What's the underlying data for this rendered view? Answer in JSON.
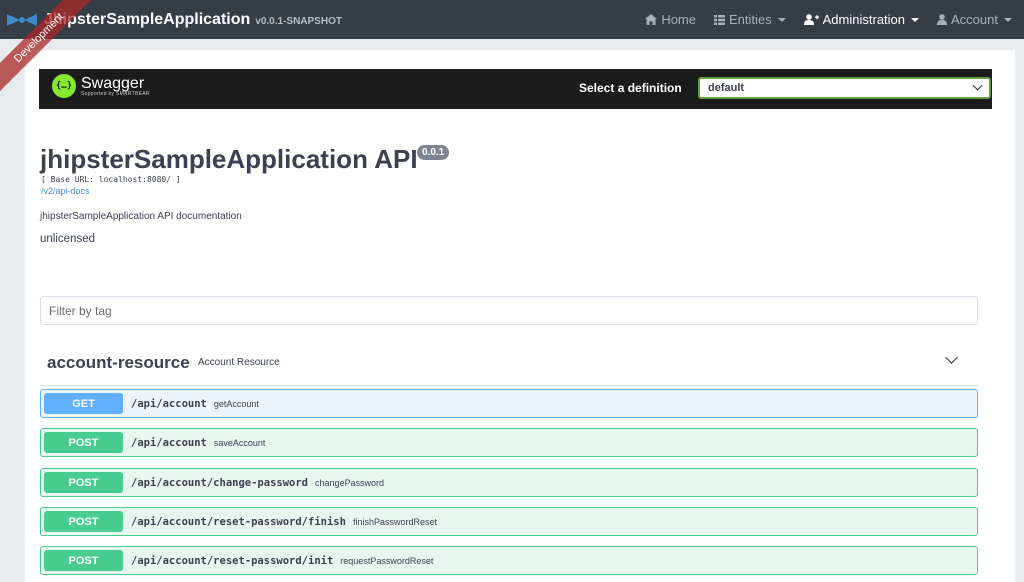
{
  "navbar": {
    "app_name": "JhipsterSampleApplication",
    "version": "v0.0.1-SNAPSHOT",
    "ribbon": "Development",
    "items": [
      {
        "label": "Home",
        "icon": "home-icon"
      },
      {
        "label": "Entities",
        "icon": "list-icon"
      },
      {
        "label": "Administration",
        "icon": "user-plus-icon"
      },
      {
        "label": "Account",
        "icon": "user-icon"
      }
    ]
  },
  "swagger": {
    "logo_text": "Swagger",
    "logo_subtext": "Supported by SMARTBEAR",
    "select_label": "Select a definition",
    "selected_definition": "default"
  },
  "info": {
    "title": "jhipsterSampleApplication API",
    "version": "0.0.1",
    "base_url": "[ Base URL: localhost:8080/ ]",
    "docs_link": "/v2/api-docs",
    "description": "jhipsterSampleApplication API documentation",
    "license": "unlicensed"
  },
  "filter": {
    "placeholder": "Filter by tag"
  },
  "tag": {
    "name": "account-resource",
    "description": "Account Resource"
  },
  "operations": [
    {
      "method": "GET",
      "path": "/api/account",
      "summary": "getAccount"
    },
    {
      "method": "POST",
      "path": "/api/account",
      "summary": "saveAccount"
    },
    {
      "method": "POST",
      "path": "/api/account/change-password",
      "summary": "changePassword"
    },
    {
      "method": "POST",
      "path": "/api/account/reset-password/finish",
      "summary": "finishPasswordReset"
    },
    {
      "method": "POST",
      "path": "/api/account/reset-password/init",
      "summary": "requestPasswordReset"
    }
  ],
  "colors": {
    "navbar": "#353d47",
    "get": "#61affe",
    "post": "#49cc90",
    "swagger_green": "#85ea2d"
  }
}
